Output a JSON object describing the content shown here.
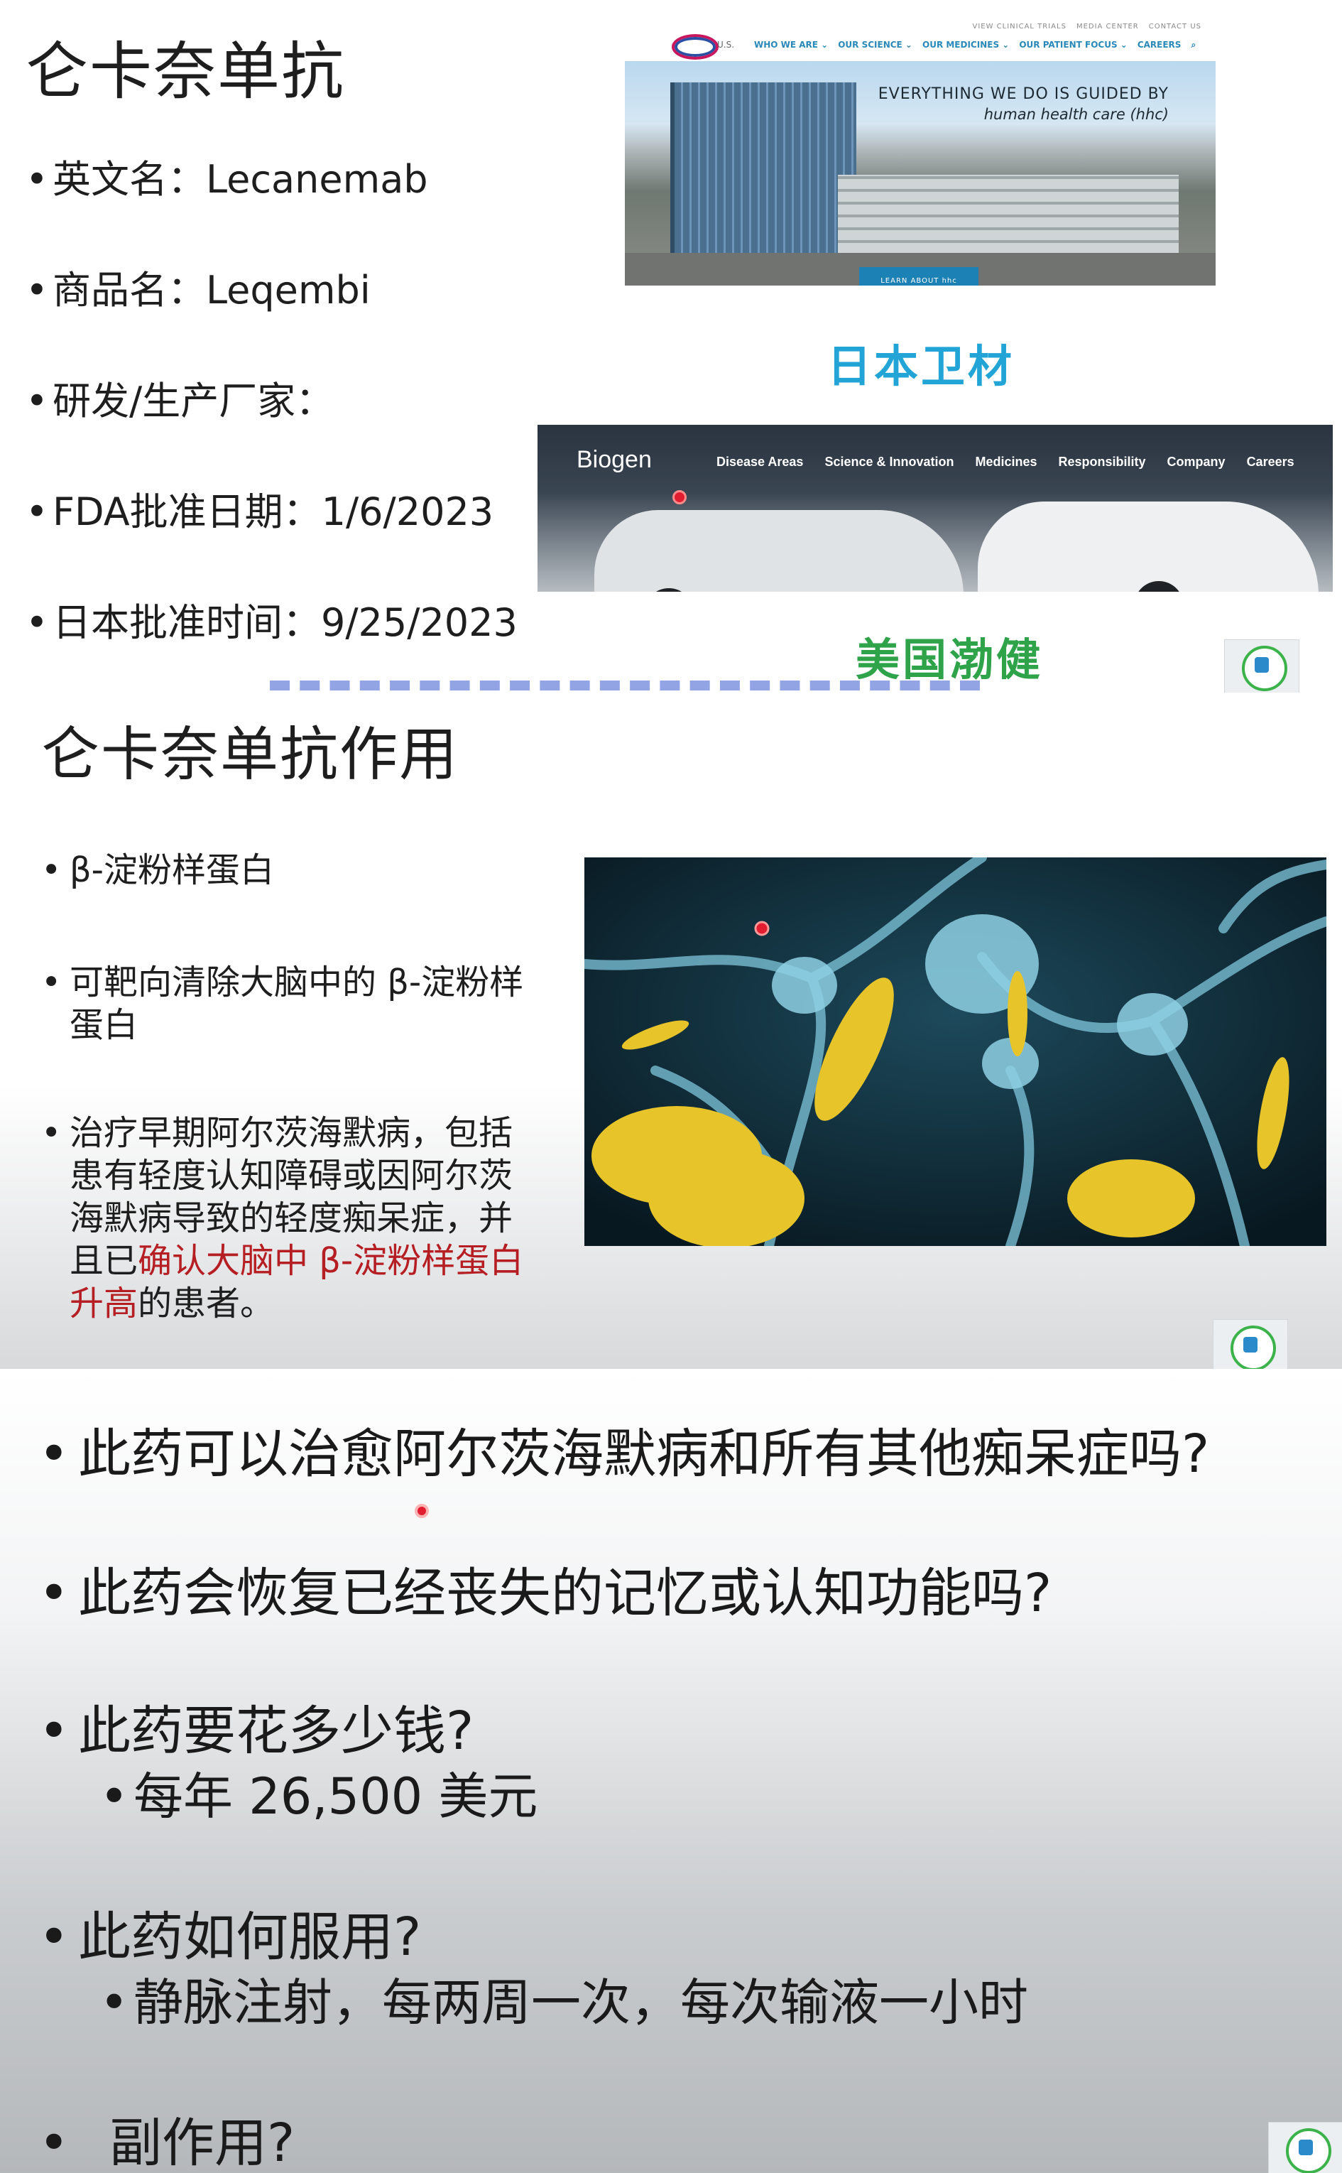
{
  "slide1": {
    "title": "仑卡奈单抗",
    "bullets": [
      "英文名：Lecanemab",
      "商品名：Leqembi",
      "研发/生产厂家：",
      "FDA批准日期：1/6/2023",
      "日本批准时间：9/25/2023"
    ],
    "eisai_site": {
      "logo_text": "Eisai",
      "region": "U.S.",
      "utility_links": [
        "VIEW CLINICAL TRIALS",
        "MEDIA CENTER",
        "CONTACT US"
      ],
      "nav": [
        "WHO WE ARE ⌄",
        "OUR SCIENCE ⌄",
        "OUR MEDICINES ⌄",
        "OUR PATIENT FOCUS ⌄",
        "CAREERS"
      ],
      "search_icon": "search-icon",
      "tagline_1": "EVERYTHING WE DO IS GUIDED BY",
      "tagline_2": "human health care (hhc)",
      "cta": "LEARN ABOUT hhc"
    },
    "eisai_label": "日本卫材",
    "biogen_site": {
      "logo": "Biogen",
      "nav": [
        "Disease Areas",
        "Science & Innovation",
        "Medicines",
        "Responsibility",
        "Company",
        "Careers"
      ]
    },
    "biogen_label": "美国渤健"
  },
  "slide2": {
    "title": "仑卡奈单抗作用",
    "bullet_1": "β-淀粉样蛋白",
    "bullet_2": "可靶向清除大脑中的 β-淀粉样蛋白",
    "bullet_3_a": "治疗早期阿尔茨海默病，包括患有轻度认知障碍或因阿尔茨海默病导致的轻度痴呆症，并且已",
    "bullet_3_highlight": "确认大脑中 β-淀粉样蛋白升高",
    "bullet_3_b": "的患者。"
  },
  "slide3": {
    "q1": "此药可以治愈阿尔茨海默病和所有其他痴呆症吗?",
    "q2": "此药会恢复已经丧失的记忆或认知功能吗?",
    "q3": "此药要花多少钱?",
    "a3": "每年 26,500 美元",
    "q4": "此药如何服用?",
    "a4": "静脉注射，每两周一次，每次输液一小时",
    "q5": "副作用?"
  },
  "colors": {
    "eisai_label": "#22a5d6",
    "biogen_label": "#2ea34a",
    "highlight": "#b51e23",
    "nav_blue": "#2a89b9"
  }
}
